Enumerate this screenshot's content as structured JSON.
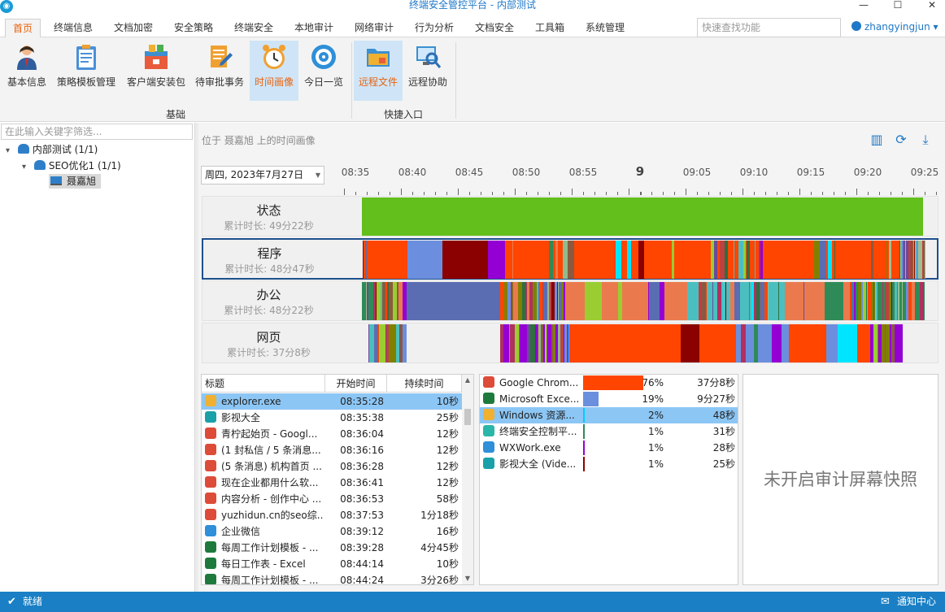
{
  "window": {
    "title": "终端安全管控平台 - 内部测试",
    "minimize": "—",
    "maximize": "☐",
    "close": "✕"
  },
  "menu": {
    "tabs": [
      "首页",
      "终端信息",
      "文档加密",
      "安全策略",
      "终端安全",
      "本地审计",
      "网络审计",
      "行为分析",
      "文档安全",
      "工具箱",
      "系统管理"
    ],
    "active": 0,
    "search_placeholder": "快速查找功能",
    "user": "zhangyingjun ▾"
  },
  "ribbon": {
    "buttons": [
      "基本信息",
      "策略模板管理",
      "客户端安装包",
      "待审批事务",
      "时间画像",
      "今日一览",
      "远程文件",
      "远程协助"
    ],
    "groups": [
      "基础",
      "快捷入口"
    ]
  },
  "tree": {
    "filter_placeholder": "在此输入关键字筛选...",
    "nodes": [
      "内部测试 (1/1)",
      "SEO优化1 (1/1)",
      "聂嘉旭"
    ]
  },
  "timeline": {
    "location": "位于 聂嘉旭 上的时间画像",
    "date": "周四, 2023年7月27日",
    "ticks": [
      "08:35",
      "08:40",
      "08:45",
      "08:50",
      "08:55",
      "9",
      "09:05",
      "09:10",
      "09:15",
      "09:20",
      "09:25"
    ],
    "rows": [
      {
        "name": "状态",
        "duration": "累计时长: 49分22秒"
      },
      {
        "name": "程序",
        "duration": "累计时长: 48分47秒"
      },
      {
        "name": "办公",
        "duration": "累计时长: 48分22秒"
      },
      {
        "name": "网页",
        "duration": "累计时长: 37分8秒"
      }
    ]
  },
  "list": {
    "headers": [
      "标题",
      "开始时间",
      "持续时间"
    ],
    "rows": [
      [
        "explorer.exe",
        "08:35:28",
        "10秒"
      ],
      [
        "影视大全",
        "08:35:38",
        "25秒"
      ],
      [
        "青柠起始页 - Googl...",
        "08:36:04",
        "12秒"
      ],
      [
        "(1 封私信 / 5 条消息...",
        "08:36:16",
        "12秒"
      ],
      [
        "(5 条消息) 机构首页 ...",
        "08:36:28",
        "12秒"
      ],
      [
        "现在企业都用什么软...",
        "08:36:41",
        "12秒"
      ],
      [
        "内容分析 - 创作中心 ...",
        "08:36:53",
        "58秒"
      ],
      [
        "yuzhidun.cn的seo综...",
        "08:37:53",
        "1分18秒"
      ],
      [
        "企业微信",
        "08:39:12",
        "16秒"
      ],
      [
        "每周工作计划模板 - ...",
        "08:39:28",
        "4分45秒"
      ],
      [
        "每日工作表 - Excel",
        "08:44:14",
        "10秒"
      ],
      [
        "每周工作计划模板 - ...",
        "08:44:24",
        "3分26秒"
      ]
    ]
  },
  "programs": [
    {
      "name": "Google Chrom...",
      "pct": "76%",
      "fraction": 0.76,
      "time": "37分8秒",
      "color": "#ff4500"
    },
    {
      "name": "Microsoft Exce...",
      "pct": "19%",
      "fraction": 0.19,
      "time": "9分27秒",
      "color": "#6b8fde"
    },
    {
      "name": "Windows 资源...",
      "pct": "2%",
      "fraction": 0.02,
      "time": "48秒",
      "color": "#00ccff"
    },
    {
      "name": "终端安全控制平...",
      "pct": "1%",
      "fraction": 0.01,
      "time": "31秒",
      "color": "#2e8b57"
    },
    {
      "name": "WXWork.exe",
      "pct": "1%",
      "fraction": 0.01,
      "time": "28秒",
      "color": "#9400d3"
    },
    {
      "name": "影视大全 (Vide...",
      "pct": "1%",
      "fraction": 0.01,
      "time": "25秒",
      "color": "#8b0000"
    }
  ],
  "screenshot_placeholder": "未开启审计屏幕快照",
  "status": {
    "left": "就绪",
    "right": "通知中心"
  }
}
